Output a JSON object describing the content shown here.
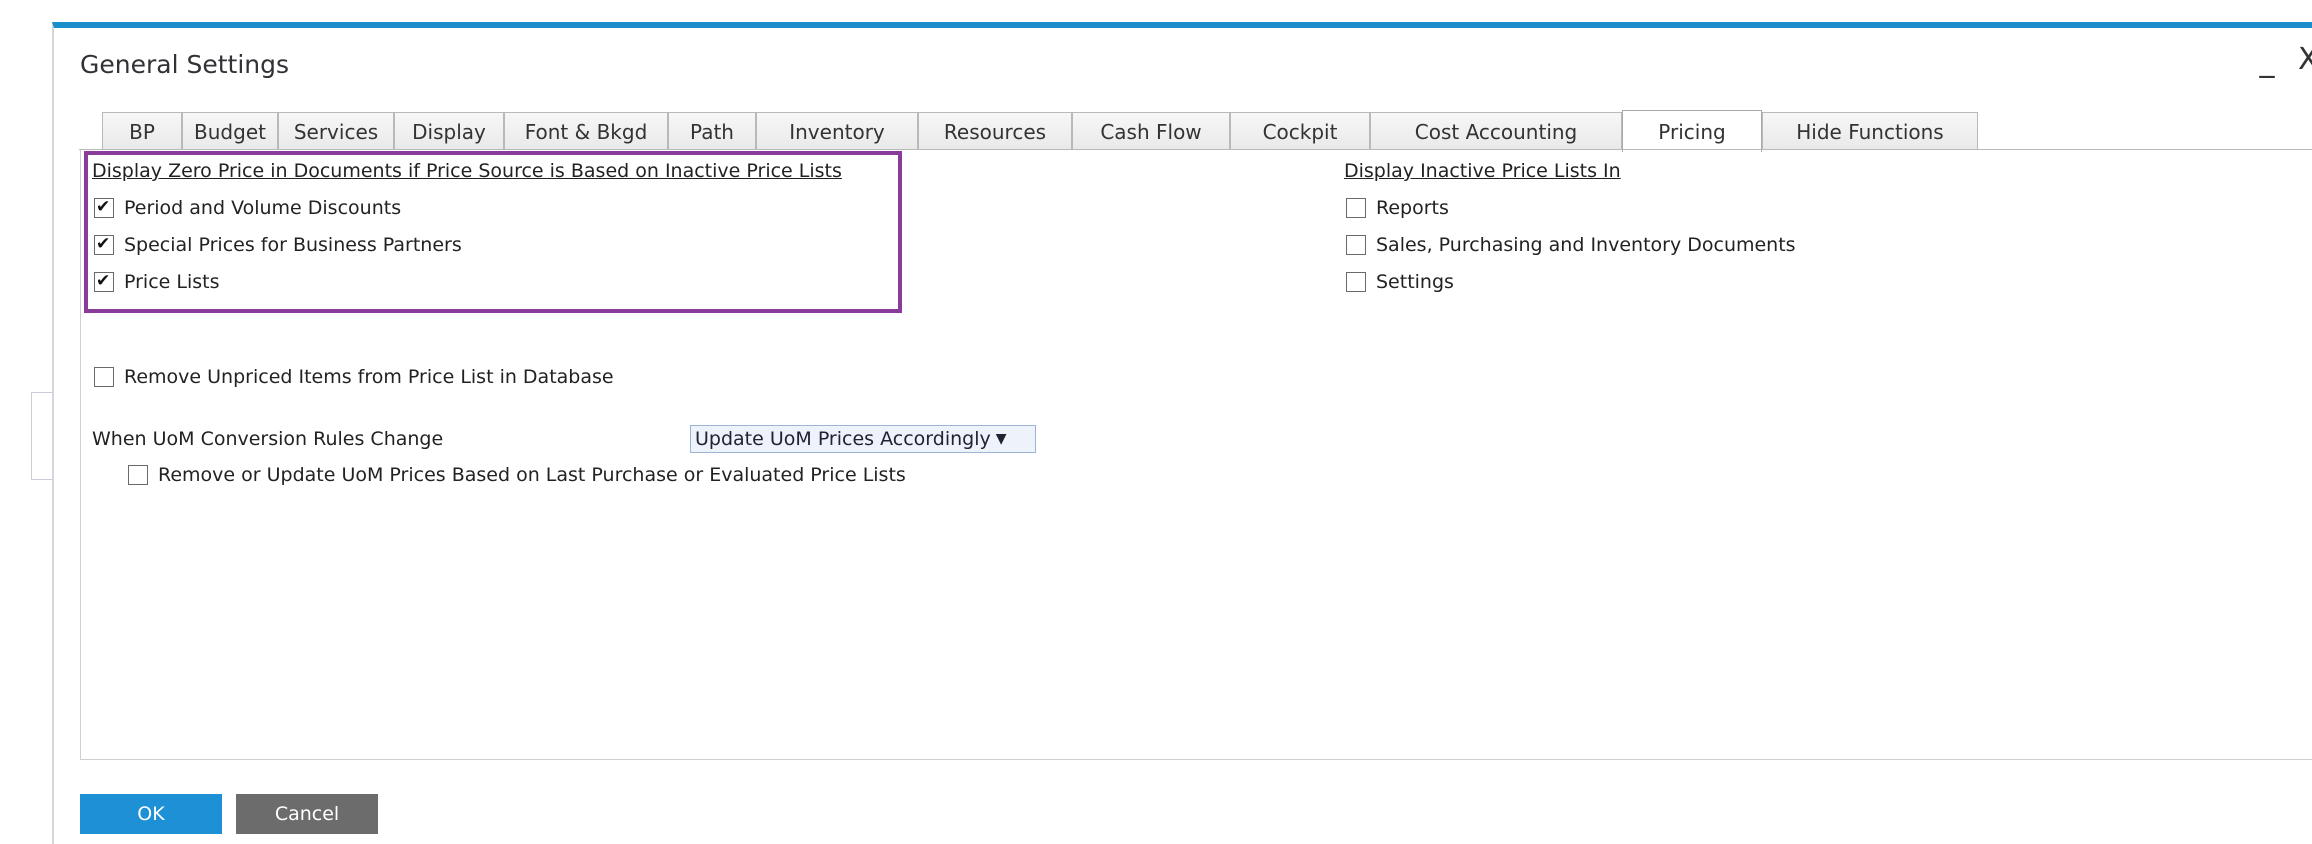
{
  "window": {
    "title": "General Settings",
    "minimize_glyph": "_",
    "close_glyph": "X"
  },
  "tabs": [
    {
      "label": "BP",
      "mnemonic": "B",
      "active": false
    },
    {
      "label": "Budget",
      "active": false
    },
    {
      "label": "Services",
      "active": false
    },
    {
      "label": "Display",
      "active": false
    },
    {
      "label": "Font & Bkgd",
      "active": false
    },
    {
      "label": "Path",
      "active": false
    },
    {
      "label": "Inventory",
      "active": false
    },
    {
      "label": "Resources",
      "active": false
    },
    {
      "label": "Cash Flow",
      "active": false
    },
    {
      "label": "Cockpit",
      "active": false
    },
    {
      "label": "Cost Accounting",
      "active": false
    },
    {
      "label": "Pricing",
      "active": true
    },
    {
      "label": "Hide Functions",
      "active": false
    }
  ],
  "pricing": {
    "zero_price_group": {
      "title": "Display Zero Price in Documents if Price Source is Based on Inactive Price Lists",
      "options": [
        {
          "label": "Period and Volume Discounts",
          "checked": true
        },
        {
          "label": "Special Prices for Business Partners",
          "checked": true
        },
        {
          "label": "Price Lists",
          "checked": true
        }
      ]
    },
    "inactive_group": {
      "title": "Display Inactive Price Lists In",
      "options": [
        {
          "label": "Reports",
          "checked": false
        },
        {
          "label": "Sales, Purchasing and Inventory Documents",
          "checked": false
        },
        {
          "label": "Settings",
          "checked": false
        }
      ]
    },
    "remove_unpriced": {
      "label": "Remove Unpriced Items from Price List in Database",
      "checked": false
    },
    "uom_rules": {
      "label": "When UoM Conversion Rules Change",
      "value": "Update UoM Prices Accordingly"
    },
    "remove_or_update": {
      "label": "Remove or Update UoM Prices Based on Last Purchase or Evaluated Price Lists",
      "checked": false
    }
  },
  "buttons": {
    "ok": "OK",
    "cancel": "Cancel"
  },
  "colors": {
    "window_accent": "#1b8fcc",
    "highlight_box": "#8a3c9a",
    "ok_button": "#1d90d6",
    "cancel_button": "#6c6c6c"
  }
}
